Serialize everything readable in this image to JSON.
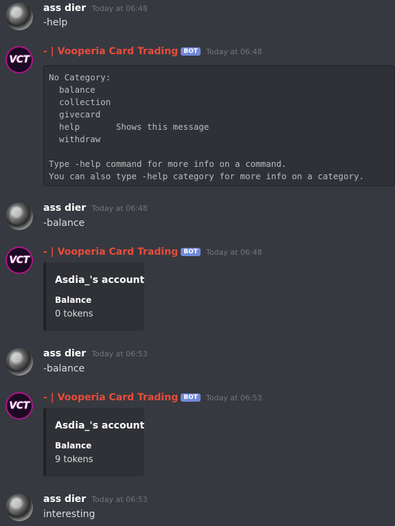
{
  "messages": [
    {
      "type": "user",
      "username": "ass dier",
      "timestamp": "Today at 06:48",
      "content": "-help"
    },
    {
      "type": "bot",
      "username": "- | Vooperia Card Trading",
      "bot_tag": "BOT",
      "avatar_text": "VCT",
      "timestamp": "Today at 06:48",
      "code_lines": [
        "No Category:",
        "  balance",
        "  collection",
        "  givecard",
        "  help       Shows this message",
        "  withdraw",
        "",
        "Type -help command for more info on a command.",
        "You can also type -help category for more info on a category."
      ]
    },
    {
      "type": "user",
      "username": "ass dier",
      "timestamp": "Today at 06:48",
      "content": "-balance"
    },
    {
      "type": "bot",
      "username": "- | Vooperia Card Trading",
      "bot_tag": "BOT",
      "avatar_text": "VCT",
      "timestamp": "Today at 06:48",
      "embed": {
        "title": "Asdia_'s account",
        "field_name": "Balance",
        "field_value": "0 tokens"
      }
    },
    {
      "type": "user",
      "username": "ass dier",
      "timestamp": "Today at 06:53",
      "content": "-balance"
    },
    {
      "type": "bot",
      "username": "- | Vooperia Card Trading",
      "bot_tag": "BOT",
      "avatar_text": "VCT",
      "timestamp": "Today at 06:53",
      "embed": {
        "title": "Asdia_'s account",
        "field_name": "Balance",
        "field_value": "9 tokens"
      }
    },
    {
      "type": "user",
      "username": "ass dier",
      "timestamp": "Today at 06:53",
      "content": "interesting"
    }
  ],
  "colors": {
    "background": "#36393f",
    "bot_name": "#e74c3c",
    "bot_tag": "#7289da",
    "embed_bg": "#2f3136"
  }
}
